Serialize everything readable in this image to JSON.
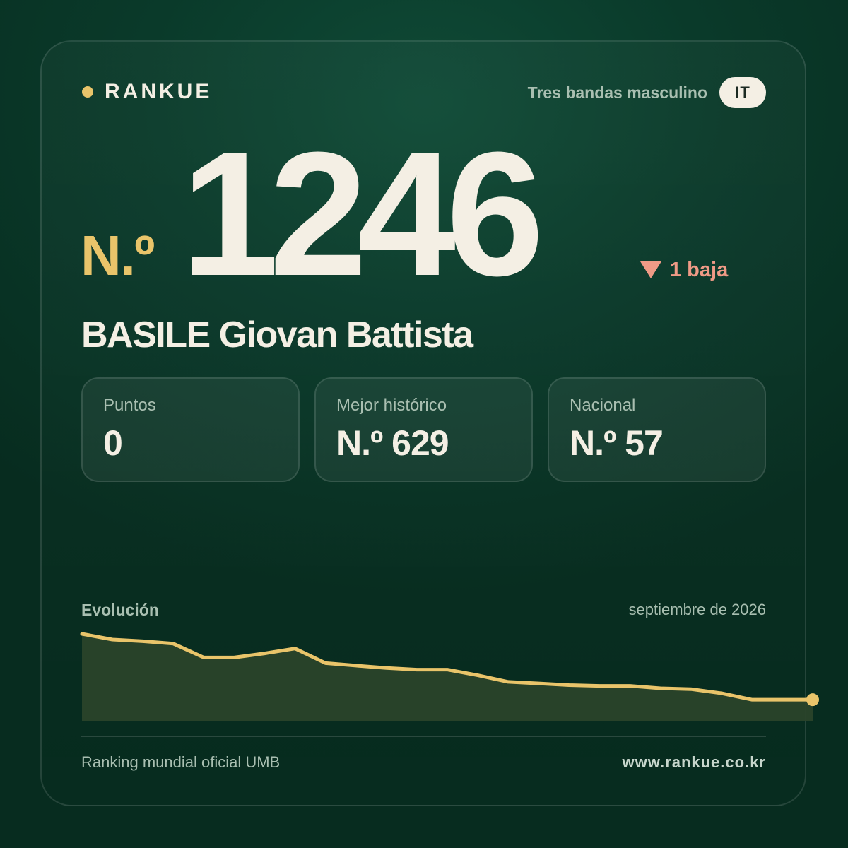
{
  "brand": {
    "name": "RANKUE"
  },
  "header": {
    "category": "Tres bandas masculino",
    "country_code": "IT"
  },
  "rank": {
    "prefix": "N.º",
    "value": "1246",
    "change_text": "1 baja"
  },
  "player": {
    "name": "BASILE Giovan Battista"
  },
  "stats": [
    {
      "label": "Puntos",
      "value": "0"
    },
    {
      "label": "Mejor histórico",
      "value": "N.º 629"
    },
    {
      "label": "Nacional",
      "value": "N.º 57"
    }
  ],
  "evolution": {
    "title": "Evolución",
    "date": "septiembre de 2026"
  },
  "footer": {
    "source": "Ranking mundial oficial UMB",
    "url": "www.rankue.co.kr"
  },
  "colors": {
    "accent": "#e9c46a",
    "down": "#ef9a86",
    "text": "#f4efe4",
    "muted": "#a9bfb1"
  },
  "chart_data": {
    "type": "area",
    "title": "",
    "xlabel": "",
    "ylabel": "",
    "y_inverted": true,
    "grid": false,
    "series": [
      {
        "values": [
          1,
          0.93,
          0.91,
          0.88,
          0.71,
          0.71,
          0.76,
          0.82,
          0.64,
          0.61,
          0.58,
          0.56,
          0.56,
          0.49,
          0.41,
          0.39,
          0.37,
          0.36,
          0.36,
          0.33,
          0.32,
          0.27,
          0.19,
          0.19,
          0.19
        ]
      }
    ]
  }
}
